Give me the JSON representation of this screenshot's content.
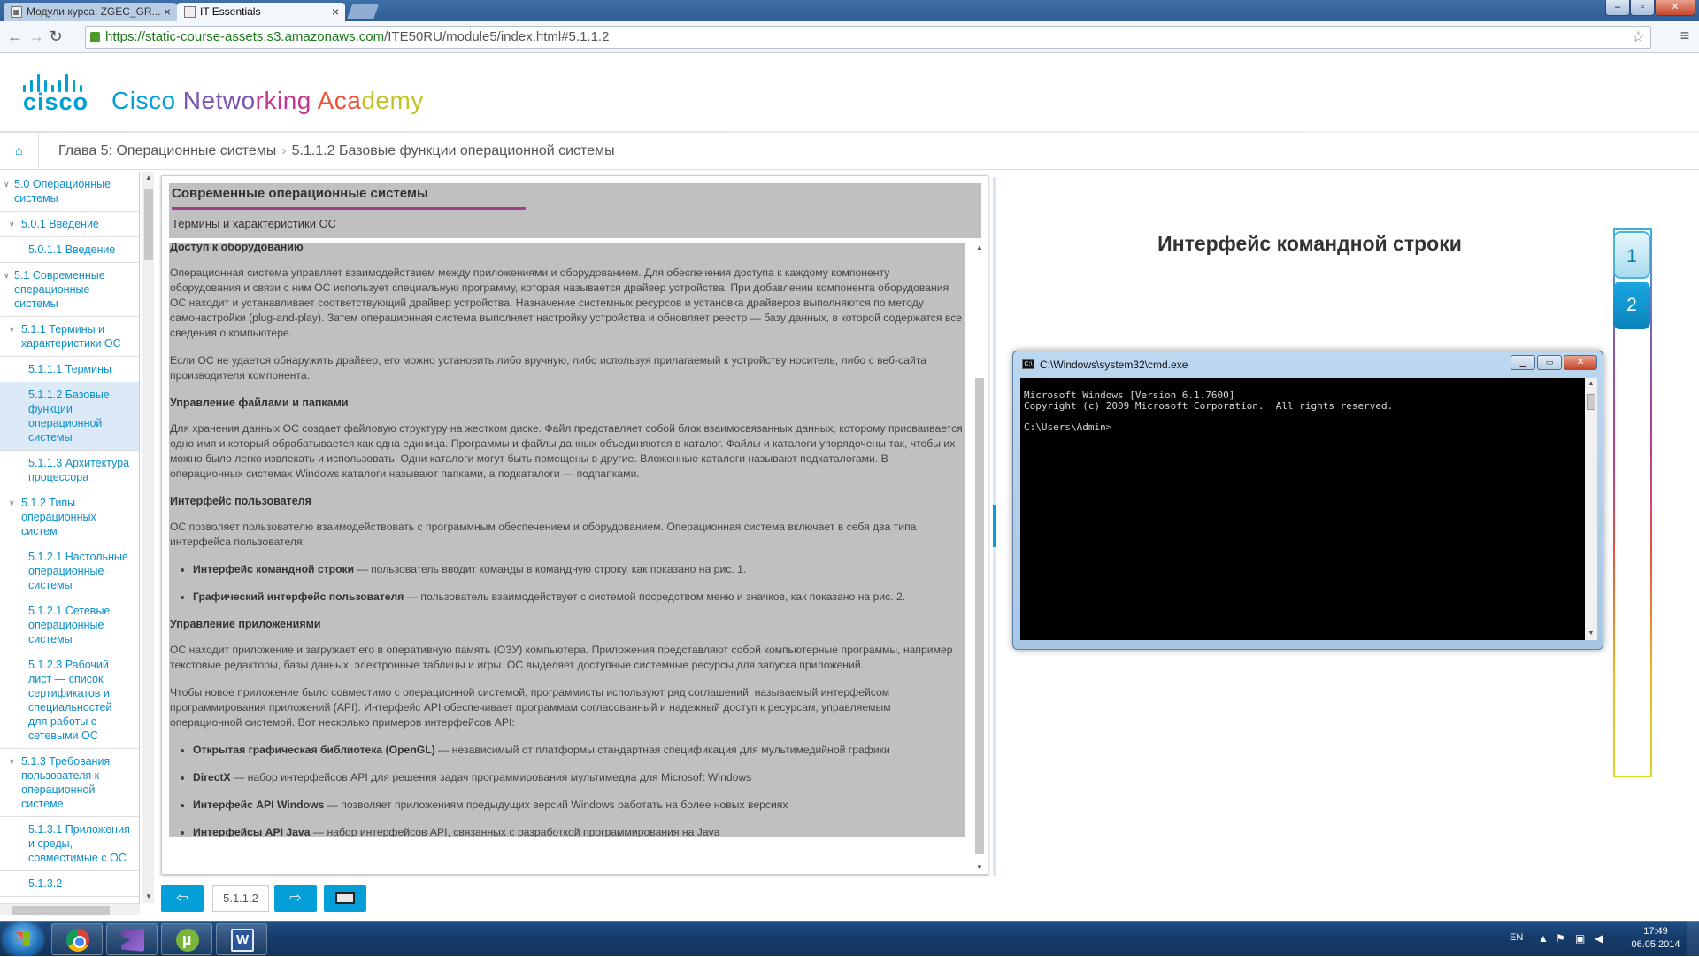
{
  "browser": {
    "tabs": [
      {
        "label": "Модули курса: ZGEC_GR..."
      },
      {
        "label": "IT Essentials"
      }
    ],
    "url_host": "https://static-course-assets.s3.amazonaws.com",
    "url_path": "/ITE50RU/module5/index.html#5.1.1.2"
  },
  "header": {
    "logo_word": "cisco",
    "brand_parts": [
      {
        "text": "Cisco ",
        "color": "#049fd9"
      },
      {
        "text": "Netwo",
        "color": "#7a55b3"
      },
      {
        "text": "rking ",
        "color": "#c4378a"
      },
      {
        "text": "Aca",
        "color": "#e8533a"
      },
      {
        "text": "demy",
        "color": "#c3c328"
      }
    ]
  },
  "breadcrumb": {
    "chapter": "Глава 5: Операционные системы",
    "current": "5.1.1.2 Базовые функции операционной системы"
  },
  "sidebar": {
    "items": [
      {
        "label": "5.0 Операционные системы",
        "level": 0,
        "active": false
      },
      {
        "label": "5.0.1 Введение",
        "level": 1,
        "active": false
      },
      {
        "label": "5.0.1.1 Введение",
        "level": 2,
        "active": false
      },
      {
        "label": "5.1 Современные операционные системы",
        "level": 0,
        "active": false
      },
      {
        "label": "5.1.1 Термины и характеристики ОС",
        "level": 1,
        "active": false
      },
      {
        "label": "5.1.1.1 Термины",
        "level": 2,
        "active": false
      },
      {
        "label": "5.1.1.2 Базовые функции операционной системы",
        "level": 2,
        "active": true
      },
      {
        "label": "5.1.1.3 Архитектура процессора",
        "level": 2,
        "active": false
      },
      {
        "label": "5.1.2 Типы операционных систем",
        "level": 1,
        "active": false
      },
      {
        "label": "5.1.2.1 Настольные операционные системы",
        "level": 2,
        "active": false
      },
      {
        "label": "5.1.2.1 Сетевые операционные системы",
        "level": 2,
        "active": false
      },
      {
        "label": "5.1.2.3 Рабочий лист — список сертификатов и специальностей для работы с сетевыми ОС",
        "level": 2,
        "active": false
      },
      {
        "label": "5.1.3 Требования пользователя к операционной системе",
        "level": 1,
        "active": false
      },
      {
        "label": "5.1.3.1 Приложения и среды, совместимые с ОС",
        "level": 2,
        "active": false
      },
      {
        "label": "5.1.3.2",
        "level": 2,
        "active": false
      }
    ]
  },
  "content": {
    "title": "Современные операционные системы",
    "subtitle": "Термины и характеристики ОС",
    "h1": "Доступ к оборудованию",
    "p1": "Операционная система управляет взаимодействием между приложениями и оборудованием. Для обеспечения доступа к каждому компоненту оборудования и связи с ним ОС использует специальную программу, которая называется драйвер устройства. При добавлении компонента оборудования ОС находит и устанавливает соответствующий драйвер устройства. Назначение системных ресурсов и установка драйверов выполняются по методу самонастройки (plug-and-play). Затем операционная система выполняет настройку устройства и обновляет реестр — базу данных, в которой содержатся все сведения о компьютере.",
    "p2": "Если ОС не удается обнаружить драйвер, его можно установить либо вручную, либо используя прилагаемый к устройству носитель, либо с веб-сайта производителя компонента.",
    "h2": "Управление файлами и папками",
    "p3": "Для хранения данных ОС создает файловую структуру на жестком диске. Файл представляет собой блок взаимосвязанных данных, которому присваивается одно имя и который обрабатывается как одна единица. Программы и файлы данных объединяются в каталог. Файлы и каталоги упорядочены так, чтобы их можно было легко извлекать и использовать. Одни каталоги могут быть помещены в другие. Вложенные каталоги называют подкаталогами. В операционных системах Windows каталоги называют папками, а подкаталоги — подпапками.",
    "h3": "Интерфейс пользователя",
    "p4": "ОС позволяет пользователю взаимодействовать с программным обеспечением и оборудованием. Операционная система включает в себя два типа интерфейса пользователя:",
    "ui_list": [
      {
        "term": "Интерфейс командной строки",
        "text": " — пользователь вводит команды в командную строку, как показано на рис. 1."
      },
      {
        "term": "Графический интерфейс пользователя",
        "text": " — пользователь взаимодействует с системой посредством меню и значков, как показано на рис. 2."
      }
    ],
    "h4": "Управление приложениями",
    "p5": "ОС находит приложение и загружает его в оперативную память (ОЗУ) компьютера. Приложения представляют собой компьютерные программы, например текстовые редакторы, базы данных, электронные таблицы и игры. ОС выделяет доступные системные ресурсы для запуска приложений.",
    "p6": "Чтобы новое приложение было совместимо с операционной системой, программисты используют ряд соглашений, называемый интерфейсом программирования приложений (API). Интерфейс API обеспечивает программам согласованный и надежный доступ к ресурсам, управляемым операционной системой. Вот несколько примеров интерфейсов API:",
    "api_list": [
      {
        "term": "Открытая графическая библиотека (OpenGL)",
        "text": " — независимый от платформы стандартная спецификация для мультимедийной графики"
      },
      {
        "term": "DirectX",
        "text": " — набор интерфейсов API для решения задач программирования мультимедиа для Microsoft Windows"
      },
      {
        "term": "Интерфейс API Windows",
        "text": " — позволяет приложениям предыдущих версий Windows работать на более новых версиях"
      },
      {
        "term": "Интерфейсы API Java",
        "text": " — набор интерфейсов API, связанных с разработкой программирования на Java"
      }
    ]
  },
  "pager": {
    "page": "5.1.1.2"
  },
  "figure": {
    "title": "Интерфейс командной строки",
    "buttons": [
      "1",
      "2"
    ],
    "window_title": "C:\\Windows\\system32\\cmd.exe",
    "console_lines": [
      "Microsoft Windows [Version 6.1.7600]",
      "Copyright (c) 2009 Microsoft Corporation.  All rights reserved.",
      "",
      "C:\\Users\\Admin>"
    ]
  },
  "taskbar": {
    "lang": "EN",
    "time": "17:49",
    "date": "06.05.2014"
  }
}
